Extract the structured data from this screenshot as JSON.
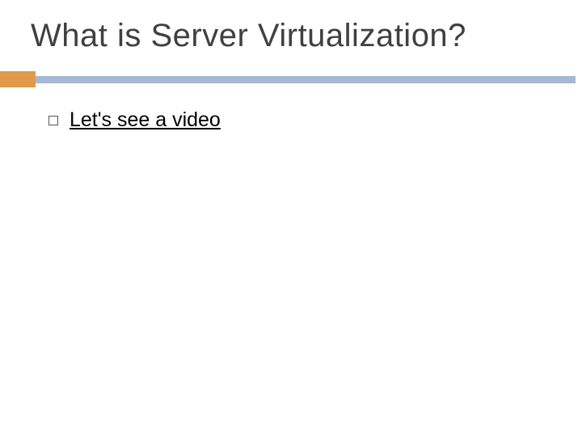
{
  "slide": {
    "title": "What is Server Virtualization?",
    "bullet_text": "Let's see a video"
  },
  "colors": {
    "accent": "#e09a4a",
    "rule": "#a6b9d2"
  }
}
